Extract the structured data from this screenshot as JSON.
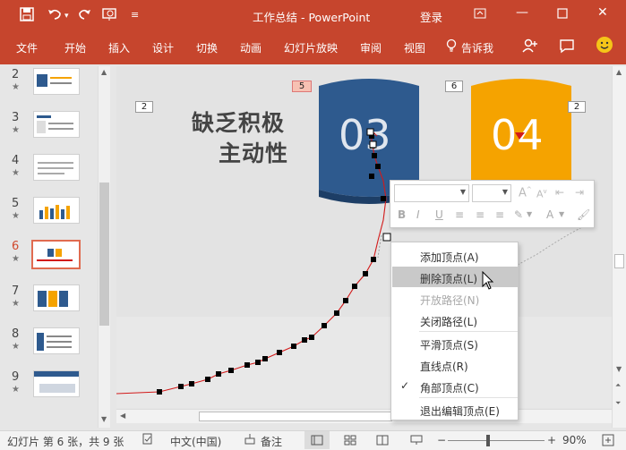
{
  "titlebar": {
    "doc_title": "工作总结  -  PowerPoint",
    "login": "登录"
  },
  "ribbon": {
    "tabs": [
      "文件",
      "开始",
      "插入",
      "设计",
      "切换",
      "动画",
      "幻灯片放映",
      "审阅",
      "视图",
      "告诉我"
    ]
  },
  "thumbnails": [
    {
      "num": "2",
      "star": "★"
    },
    {
      "num": "3",
      "star": "★"
    },
    {
      "num": "4",
      "star": "★"
    },
    {
      "num": "5",
      "star": "★"
    },
    {
      "num": "6",
      "star": "★"
    },
    {
      "num": "7",
      "star": "★"
    },
    {
      "num": "8",
      "star": "★"
    },
    {
      "num": "9",
      "star": "★"
    }
  ],
  "slide": {
    "heading_line1": "缺乏积极",
    "heading_line2": "主动性",
    "card3_num": "03",
    "card4_num": "04",
    "badge_left": "2",
    "badge_card3": "5",
    "badge_card4": "6",
    "badge_right": "2"
  },
  "context_menu": {
    "items": [
      {
        "label": "添加顶点(A)",
        "state": "normal"
      },
      {
        "label": "删除顶点(L)",
        "state": "hover"
      },
      {
        "label": "开放路径(N)",
        "state": "disabled"
      },
      {
        "label": "关闭路径(L)",
        "state": "normal"
      },
      {
        "label": "平滑顶点(S)",
        "state": "normal"
      },
      {
        "label": "直线点(R)",
        "state": "normal"
      },
      {
        "label": "角部顶点(C)",
        "state": "checked"
      },
      {
        "label": "退出编辑顶点(E)",
        "state": "normal"
      }
    ]
  },
  "statusbar": {
    "slide_info": "幻灯片 第 6 张，共 9 张",
    "language": "中文(中国)",
    "notes": "备注",
    "zoom": "90%"
  },
  "colors": {
    "accent": "#c6452d",
    "card3": "#2e5a8e",
    "card4": "#f5a300",
    "path": "#d21a1a"
  }
}
